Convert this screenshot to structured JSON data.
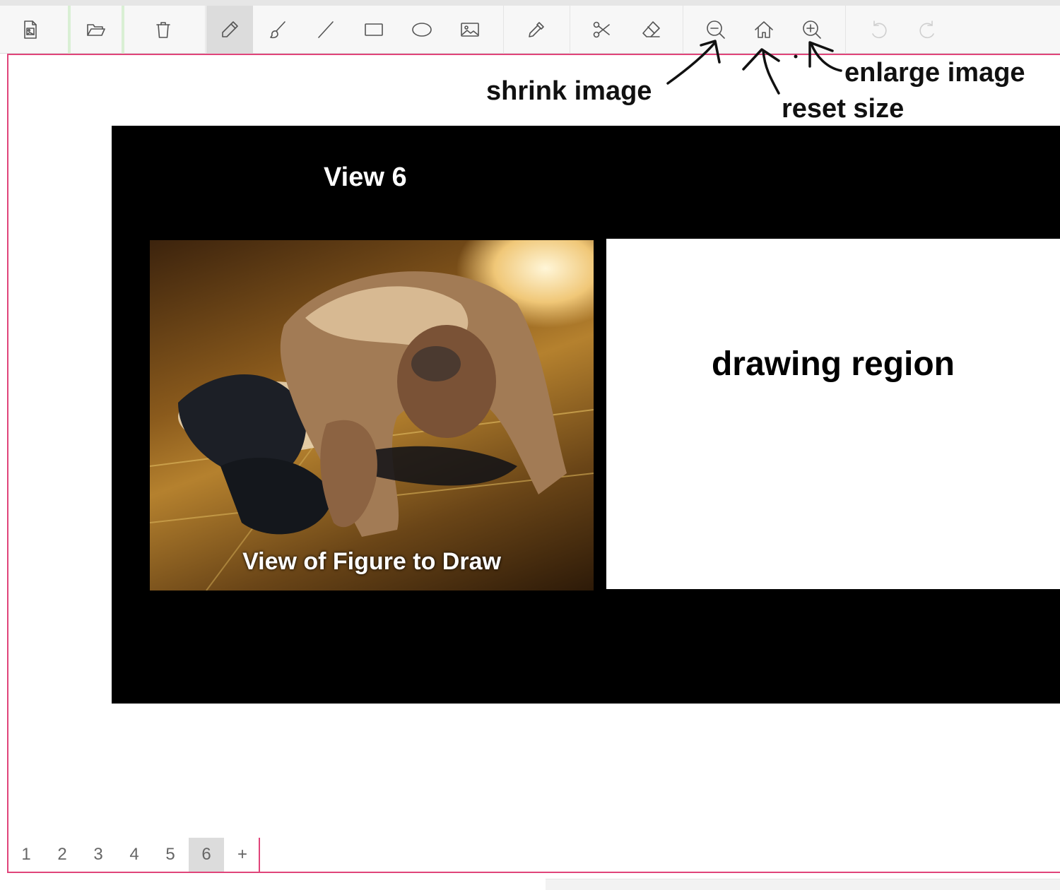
{
  "toolbar": {
    "buttons": [
      {
        "icon": "new-image-icon"
      },
      {
        "icon": "folder-open-icon"
      },
      {
        "icon": "trash-icon"
      },
      {
        "icon": "pencil-icon",
        "active": true
      },
      {
        "icon": "brush-icon"
      },
      {
        "icon": "line-icon"
      },
      {
        "icon": "rectangle-icon"
      },
      {
        "icon": "ellipse-icon"
      },
      {
        "icon": "image-icon"
      },
      {
        "icon": "eyedropper-icon"
      },
      {
        "icon": "scissors-icon"
      },
      {
        "icon": "eraser-icon"
      },
      {
        "icon": "zoom-out-icon"
      },
      {
        "icon": "home-icon"
      },
      {
        "icon": "zoom-in-icon"
      },
      {
        "icon": "undo-icon",
        "disabled": true
      },
      {
        "icon": "redo-icon",
        "disabled": true
      }
    ]
  },
  "annotations": {
    "shrink": "shrink image",
    "reset": "reset size",
    "enlarge": "enlarge image"
  },
  "slide": {
    "title": "View 6",
    "photo_caption": "View of Figure to Draw",
    "drawing_label": "drawing region"
  },
  "tabs": {
    "pages": [
      "1",
      "2",
      "3",
      "4",
      "5",
      "6"
    ],
    "active": "6",
    "add": "+"
  },
  "colors": {
    "accent_border": "#e0447a",
    "toolbar_bg": "#f7f7f7",
    "slide_bg": "#000000"
  }
}
